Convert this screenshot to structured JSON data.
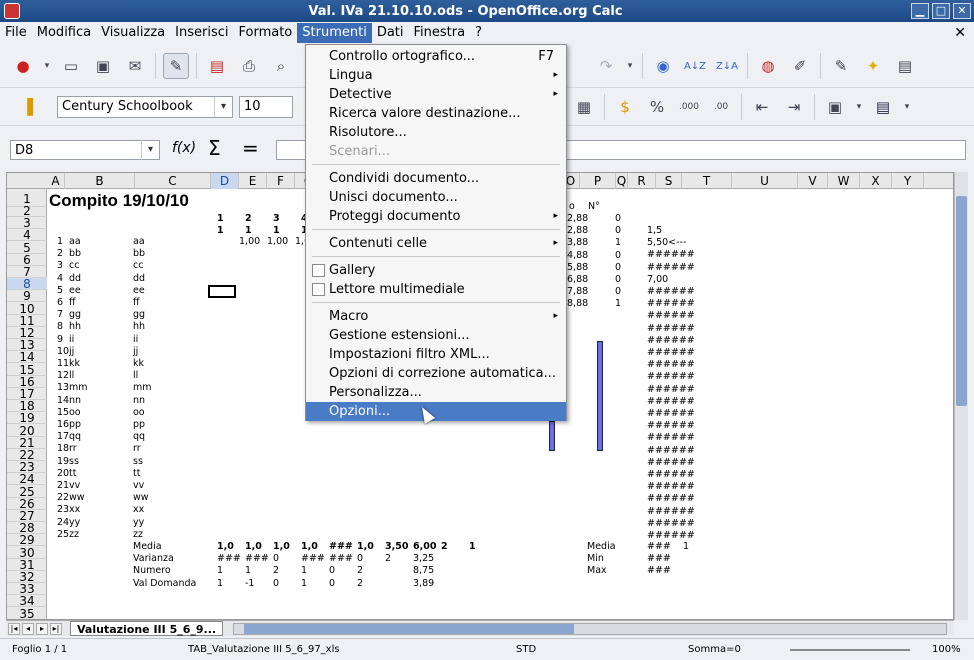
{
  "window": {
    "title": "Val. IVa 21.10.10.ods - OpenOffice.org Calc"
  },
  "menubar": [
    "File",
    "Modifica",
    "Visualizza",
    "Inserisci",
    "Formato",
    "Strumenti",
    "Dati",
    "Finestra",
    "?"
  ],
  "formatting": {
    "font_name": "Century Schoolbook",
    "font_size": "10"
  },
  "formula_bar": {
    "cell_ref": "D8",
    "fx": "f(x)",
    "sum": "Σ",
    "equals": "="
  },
  "strumenti_menu": [
    {
      "label": "Controllo ortografico...",
      "shortcut": "F7"
    },
    {
      "label": "Lingua",
      "submenu": true
    },
    {
      "label": "Detective",
      "submenu": true
    },
    {
      "label": "Ricerca valore destinazione..."
    },
    {
      "label": "Risolutore..."
    },
    {
      "label": "Scenari...",
      "disabled": true
    },
    {
      "label": "Condividi documento..."
    },
    {
      "label": "Unisci documento..."
    },
    {
      "label": "Proteggi documento",
      "submenu": true
    },
    {
      "label": "Contenuti celle",
      "submenu": true
    },
    {
      "label": "Gallery",
      "check": true
    },
    {
      "label": "Lettore multimediale",
      "check": true
    },
    {
      "label": "Macro",
      "submenu": true
    },
    {
      "label": "Gestione estensioni..."
    },
    {
      "label": "Impostazioni filtro XML..."
    },
    {
      "label": "Opzioni di correzione automatica..."
    },
    {
      "label": "Personalizza..."
    },
    {
      "label": "Opzioni...",
      "highlighted": true
    }
  ],
  "sheet": {
    "columns": [
      "A",
      "B",
      "C",
      "D",
      "E",
      "F",
      "G",
      "H",
      "I",
      "J",
      "K",
      "L",
      "M",
      "N",
      "O",
      "P",
      "Q",
      "R",
      "S",
      "T",
      "U",
      "V",
      "W",
      "X",
      "Y"
    ],
    "rows": [
      "1",
      "2",
      "3",
      "4",
      "5",
      "6",
      "7",
      "8",
      "9",
      "10",
      "11",
      "12",
      "13",
      "14",
      "15",
      "16",
      "17",
      "18",
      "19",
      "20",
      "21",
      "22",
      "23",
      "24",
      "25",
      "26",
      "27",
      "28",
      "29",
      "30",
      "31",
      "32",
      "33",
      "34",
      "35"
    ],
    "title": "Compito 19/10/10",
    "header_nums": [
      "1",
      "2",
      "3",
      "4"
    ],
    "header_nums2": [
      "1",
      "1",
      "1",
      "1"
    ],
    "students": [
      {
        "n": "1",
        "a": "aa",
        "b": "aa"
      },
      {
        "n": "2",
        "a": "bb",
        "b": "bb"
      },
      {
        "n": "3",
        "a": "cc",
        "b": "cc"
      },
      {
        "n": "4",
        "a": "dd",
        "b": "dd"
      },
      {
        "n": "5",
        "a": "ee",
        "b": "ee"
      },
      {
        "n": "6",
        "a": "ff",
        "b": "ff"
      },
      {
        "n": "7",
        "a": "gg",
        "b": "gg"
      },
      {
        "n": "8",
        "a": "hh",
        "b": "hh"
      },
      {
        "n": "9",
        "a": "ii",
        "b": "ii"
      },
      {
        "n": "10",
        "a": "jj",
        "b": "jj"
      },
      {
        "n": "11",
        "a": "kk",
        "b": "kk"
      },
      {
        "n": "12",
        "a": "ll",
        "b": "ll"
      },
      {
        "n": "13",
        "a": "mm",
        "b": "mm"
      },
      {
        "n": "14",
        "a": "nn",
        "b": "nn"
      },
      {
        "n": "15",
        "a": "oo",
        "b": "oo"
      },
      {
        "n": "16",
        "a": "pp",
        "b": "pp"
      },
      {
        "n": "17",
        "a": "qq",
        "b": "qq"
      },
      {
        "n": "18",
        "a": "rr",
        "b": "rr"
      },
      {
        "n": "19",
        "a": "ss",
        "b": "ss"
      },
      {
        "n": "20",
        "a": "tt",
        "b": "tt"
      },
      {
        "n": "21",
        "a": "vv",
        "b": "vv"
      },
      {
        "n": "22",
        "a": "ww",
        "b": "ww"
      },
      {
        "n": "23",
        "a": "xx",
        "b": "xx"
      },
      {
        "n": "24",
        "a": "yy",
        "b": "yy"
      },
      {
        "n": "25",
        "a": "zz",
        "b": "zz"
      }
    ],
    "right_header": [
      "o",
      "N°"
    ],
    "right_vals": [
      [
        "2,88",
        "0"
      ],
      [
        "2,88",
        "0"
      ],
      [
        "3,88",
        "1"
      ],
      [
        "4,88",
        "0"
      ],
      [
        "5,88",
        "0"
      ],
      [
        "6,88",
        "0"
      ],
      [
        "7,88",
        "0"
      ],
      [
        "8,88",
        "1"
      ]
    ],
    "r_col": [
      "1,5",
      "5,50<---",
      "######",
      "######",
      "7,00",
      "######",
      "######",
      "######",
      "######",
      "######",
      "######",
      "######",
      "######",
      "######",
      "######",
      "######",
      "######",
      "######",
      "######",
      "######",
      "######",
      "######",
      "######",
      "######",
      "######",
      "######"
    ],
    "summary_labels": [
      "Media",
      "Varianza",
      "Numero",
      "Val Domanda"
    ],
    "summary_rows": [
      [
        "1,0",
        "1,0",
        "1,0",
        "1,0",
        "###",
        "1,0",
        "3,50",
        "6,00",
        "2",
        "1"
      ],
      [
        "###",
        "###",
        "0",
        "###",
        "###",
        "0",
        "2",
        "3,25"
      ],
      [
        "1",
        "1",
        "2",
        "1",
        "0",
        "2",
        "",
        "8,75"
      ],
      [
        "1",
        "-1",
        "0",
        "1",
        "0",
        "2",
        "",
        "3,89"
      ]
    ],
    "stats_labels": [
      "Media",
      "Min",
      "Max"
    ],
    "stats_vals": [
      "###",
      "###",
      "###"
    ],
    "stats_extra": "1",
    "d_vals": [
      "1,00",
      "1,00",
      "1,00"
    ]
  },
  "sheet_tab": "Valutazione III 5_6_9...",
  "status": {
    "sheet": "Foglio 1 / 1",
    "style": "TAB_Valutazione III 5_6_97_xls",
    "mode": "STD",
    "sum": "Somma=0",
    "zoom": "100%"
  }
}
